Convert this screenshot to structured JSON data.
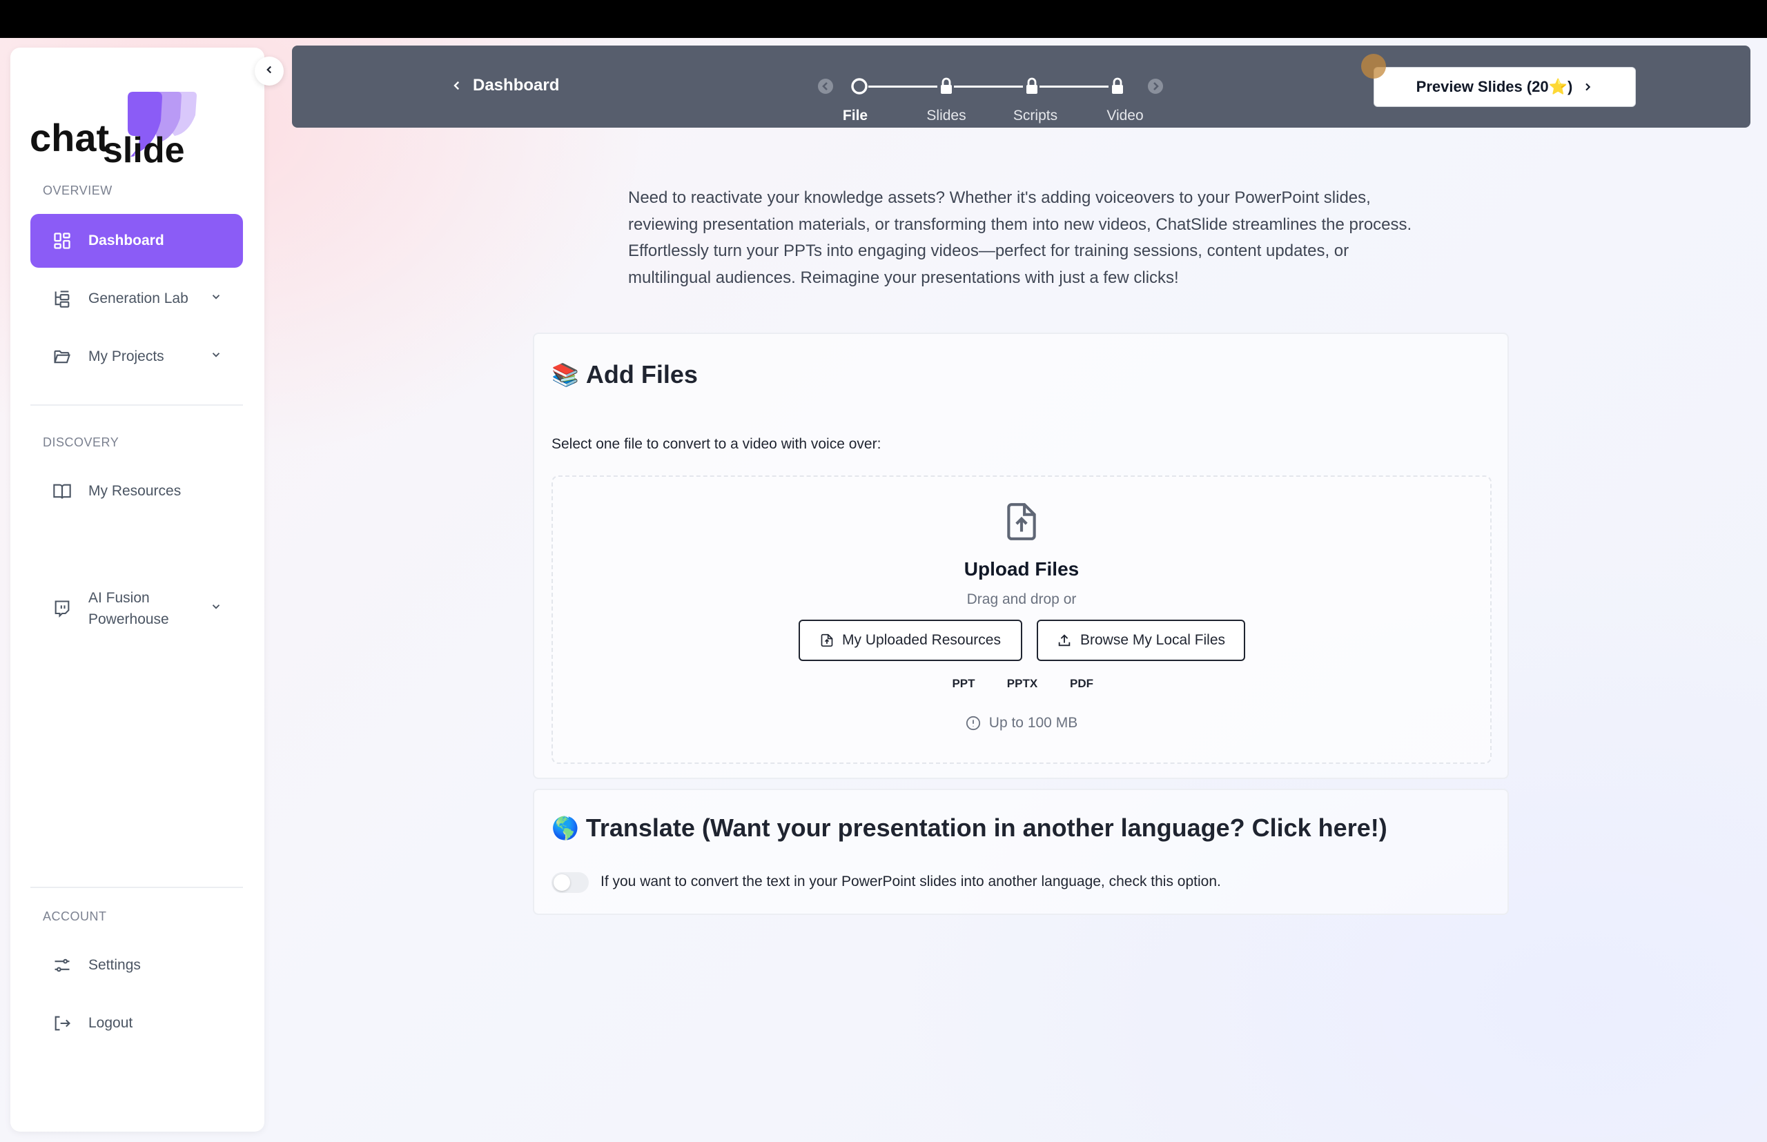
{
  "brand": {
    "logo_text_a": "chat",
    "logo_text_b": "slide",
    "accent": "#8b5cf6"
  },
  "sidebar": {
    "sections": {
      "overview": "OVERVIEW",
      "discovery": "DISCOVERY",
      "account": "ACCOUNT"
    },
    "items": [
      {
        "label": "Dashboard",
        "icon": "dashboard-grid-icon",
        "active": true
      },
      {
        "label": "Generation Lab",
        "icon": "tree-icon",
        "expandable": true
      },
      {
        "label": "My Projects",
        "icon": "folder-open-icon",
        "expandable": true
      },
      {
        "label": "My Resources",
        "icon": "book-open-icon"
      },
      {
        "label": "AI Fusion\nPowerhouse",
        "icon": "twitch-chat-icon",
        "expandable": true
      },
      {
        "label": "Settings",
        "icon": "sliders-icon"
      },
      {
        "label": "Logout",
        "icon": "logout-icon"
      }
    ]
  },
  "topbar": {
    "back_label": "Dashboard",
    "steps": [
      {
        "label": "File",
        "state": "current"
      },
      {
        "label": "Slides",
        "state": "locked"
      },
      {
        "label": "Scripts",
        "state": "locked"
      },
      {
        "label": "Video",
        "state": "locked"
      }
    ],
    "preview_label": "Preview Slides (20⭐)"
  },
  "intro": "Need to reactivate your knowledge assets? Whether it's adding voiceovers to your PowerPoint slides, reviewing presentation materials, or transforming them into new videos, ChatSlide streamlines the process. Effortlessly turn your PPTs into engaging videos—perfect for training sessions, content updates, or multilingual audiences. Reimagine your presentations with just a few clicks!",
  "add_files": {
    "emoji": "📚",
    "title": "Add Files",
    "subtitle": "Select one file to convert to a video with voice over:",
    "upload_title": "Upload Files",
    "upload_sub": "Drag and drop or",
    "uploaded_resources_label": "My Uploaded Resources",
    "browse_label": "Browse My Local Files",
    "file_types": [
      "PPT",
      "PPTX",
      "PDF"
    ],
    "limit": "Up to 100 MB"
  },
  "translate": {
    "emoji": "🌎",
    "title": "Translate (Want your presentation in another language? Click here!)",
    "toggle_label": "If you want to convert the text in your PowerPoint slides into another language, check this option.",
    "toggle_on": false
  }
}
